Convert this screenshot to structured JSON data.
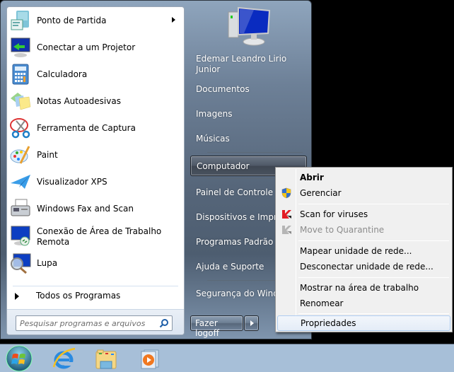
{
  "start_menu": {
    "programs": [
      {
        "label": "Ponto de Partida",
        "icon": "getting-started-icon",
        "has_submenu": true
      },
      {
        "label": "Conectar a um Projetor",
        "icon": "projector-icon",
        "has_submenu": false
      },
      {
        "label": "Calculadora",
        "icon": "calculator-icon",
        "has_submenu": false
      },
      {
        "label": "Notas Autoadesivas",
        "icon": "sticky-notes-icon",
        "has_submenu": false
      },
      {
        "label": "Ferramenta de Captura",
        "icon": "snipping-tool-icon",
        "has_submenu": false
      },
      {
        "label": "Paint",
        "icon": "paint-icon",
        "has_submenu": false
      },
      {
        "label": "Visualizador XPS",
        "icon": "xps-viewer-icon",
        "has_submenu": false
      },
      {
        "label": "Windows Fax and Scan",
        "icon": "fax-scan-icon",
        "has_submenu": false
      },
      {
        "label": "Conexão de Área de Trabalho",
        "label2": "Remota",
        "icon": "remote-desktop-icon",
        "has_submenu": false
      },
      {
        "label": "Lupa",
        "icon": "magnifier-icon",
        "has_submenu": false
      }
    ],
    "all_programs_label": "Todos os Programas",
    "search_placeholder": "Pesquisar programas e arquivos",
    "right_pane": {
      "user_name_line1": "Edemar Leandro Lirio",
      "user_name_line2": "Junior",
      "items": [
        {
          "label": "Documentos"
        },
        {
          "label": "Imagens"
        },
        {
          "label": "Músicas"
        },
        {
          "label": "Computador",
          "highlighted": true
        },
        {
          "label": "Painel de Controle"
        },
        {
          "label": "Dispositivos e Impressoras"
        },
        {
          "label": "Programas Padrão"
        },
        {
          "label": "Ajuda e Suporte"
        },
        {
          "label": "Segurança do Windows"
        }
      ]
    },
    "logoff_label": "Fazer logoff"
  },
  "context_menu": {
    "items": [
      {
        "label": "Abrir",
        "bold": true
      },
      {
        "label": "Gerenciar",
        "icon": "uac-shield-icon"
      },
      {
        "label": "Scan for viruses",
        "icon": "kaspersky-icon"
      },
      {
        "label": "Move to Quarantine",
        "icon": "kaspersky-disabled-icon",
        "disabled": true
      },
      {
        "label": "Mapear unidade de rede..."
      },
      {
        "label": "Desconectar unidade de rede..."
      },
      {
        "label": "Mostrar na área de trabalho"
      },
      {
        "label": "Renomear"
      },
      {
        "label": "Propriedades",
        "highlighted": true
      }
    ]
  },
  "taskbar": {
    "items": [
      "start-orb",
      "internet-explorer",
      "windows-explorer",
      "media-player"
    ]
  }
}
